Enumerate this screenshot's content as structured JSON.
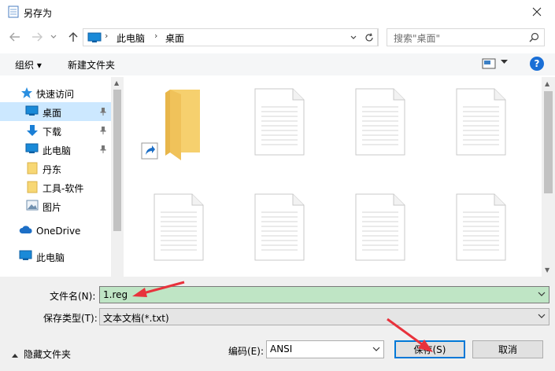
{
  "window": {
    "title": "另存为"
  },
  "address": {
    "crumbs": [
      "此电脑",
      "桌面"
    ]
  },
  "search": {
    "placeholder": "搜索\"桌面\""
  },
  "toolbar": {
    "organize": "组织 ▾",
    "new_folder": "新建文件夹",
    "help": "?"
  },
  "sidebar": {
    "items": [
      {
        "label": "快速访问"
      },
      {
        "label": "桌面"
      },
      {
        "label": "下载"
      },
      {
        "label": "此电脑"
      },
      {
        "label": "丹东"
      },
      {
        "label": "工具-软件"
      },
      {
        "label": "图片"
      },
      {
        "label": "OneDrive"
      },
      {
        "label": "此电脑"
      }
    ]
  },
  "form": {
    "filename_label": "文件名(N):",
    "filename_value": "1.reg",
    "filetype_label": "保存类型(T):",
    "filetype_value": "文本文档(*.txt)",
    "encoding_label": "编码(E):",
    "encoding_value": "ANSI",
    "save_label": "保存(S)",
    "cancel_label": "取消",
    "hide_folders": "隐藏文件夹"
  },
  "colors": {
    "accent": "#0078d7",
    "selection": "#cce8ff",
    "annotation_arrow": "#e8323c"
  }
}
